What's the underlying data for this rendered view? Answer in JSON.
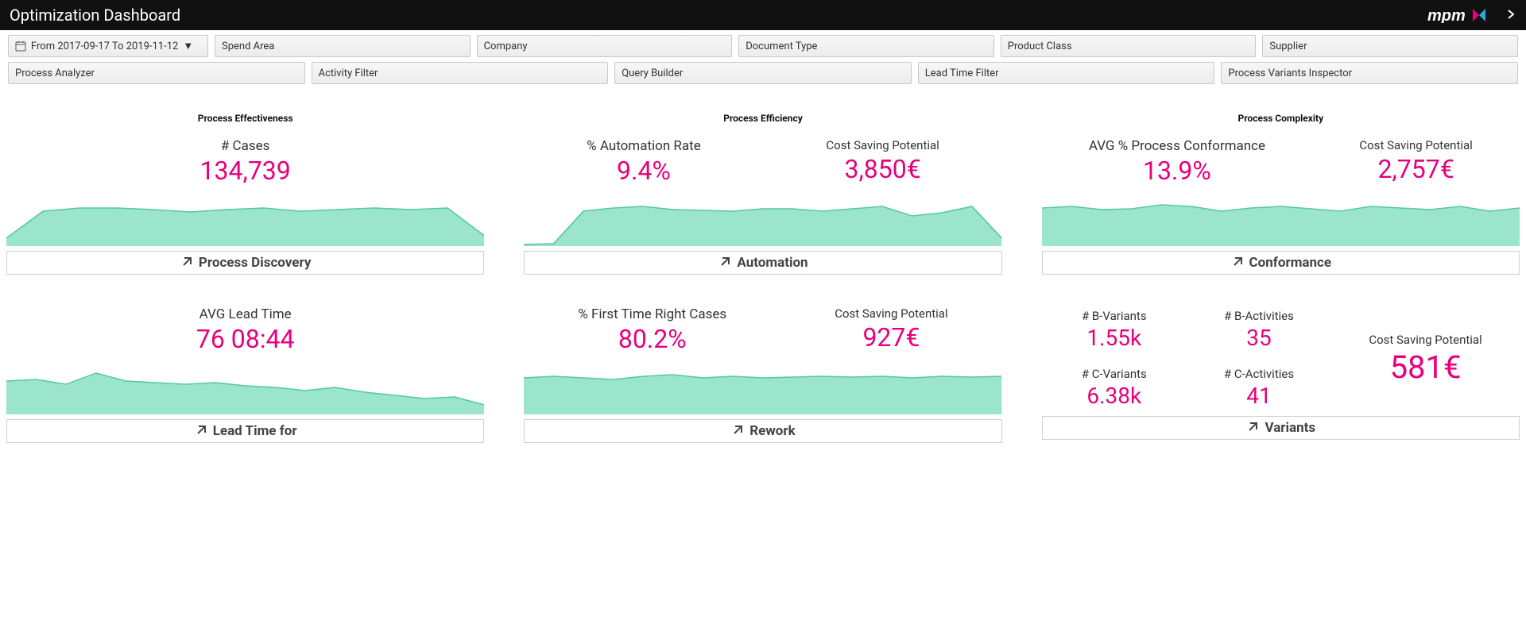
{
  "header": {
    "title": "Optimization Dashboard"
  },
  "filters": {
    "date": "From 2017-09-17 To 2019-11-12",
    "f1": "Spend Area",
    "f2": "Company",
    "f3": "Document Type",
    "f4": "Product Class",
    "f5": "Supplier",
    "t1": "Process Analyzer",
    "t2": "Activity Filter",
    "t3": "Query Builder",
    "t4": "Lead Time Filter",
    "t5": "Process Variants Inspector"
  },
  "sections": {
    "s1": {
      "title": "Process Effectiveness"
    },
    "s2": {
      "title": "Process Efficiency"
    },
    "s3": {
      "title": "Process Complexity"
    }
  },
  "kpi": {
    "cases_label": "# Cases",
    "cases_value": "134,739",
    "autorate_label": "% Automation Rate",
    "autorate_value": "9.4%",
    "csp_label": "Cost Saving Potential",
    "auto_csp": "3,850€",
    "conf_label": "AVG % Process Conformance",
    "conf_value": "13.9%",
    "conf_csp": "2,757€",
    "lead_label": "AVG Lead Time",
    "lead_value": "76 08:44",
    "ftr_label": "% First Time Right Cases",
    "ftr_value": "80.2%",
    "ftr_csp": "927€",
    "bvar_label": "# B-Variants",
    "bvar_value": "1.55k",
    "bact_label": "# B-Activities",
    "bact_value": "35",
    "cvar_label": "# C-Variants",
    "cvar_value": "6.38k",
    "cact_label": "# C-Activities",
    "cact_value": "41",
    "var_csp": "581€"
  },
  "links": {
    "l1": "Process Discovery",
    "l2": "Automation",
    "l3": "Conformance",
    "l4": "Lead Time for",
    "l5": "Rework",
    "l6": "Variants"
  },
  "chart_data": [
    {
      "type": "area",
      "panel": "cases",
      "values": [
        10,
        44,
        48,
        48,
        46,
        43,
        46,
        48,
        44,
        46,
        48,
        46,
        48,
        13
      ]
    },
    {
      "type": "area",
      "panel": "automation",
      "values": [
        2,
        3,
        44,
        48,
        50,
        46,
        45,
        44,
        47,
        47,
        44,
        47,
        50,
        38,
        42,
        50,
        10
      ]
    },
    {
      "type": "area",
      "panel": "conformance",
      "values": [
        48,
        50,
        46,
        47,
        52,
        50,
        44,
        48,
        50,
        47,
        44,
        50,
        48,
        46,
        50,
        44,
        48
      ]
    },
    {
      "type": "area",
      "panel": "leadtime",
      "values": [
        42,
        44,
        38,
        52,
        42,
        40,
        38,
        40,
        36,
        34,
        30,
        34,
        28,
        24,
        20,
        22,
        12
      ]
    },
    {
      "type": "area",
      "panel": "rework",
      "values": [
        46,
        48,
        46,
        44,
        48,
        50,
        46,
        48,
        46,
        47,
        48,
        47,
        48,
        46,
        48,
        47,
        48
      ]
    }
  ]
}
